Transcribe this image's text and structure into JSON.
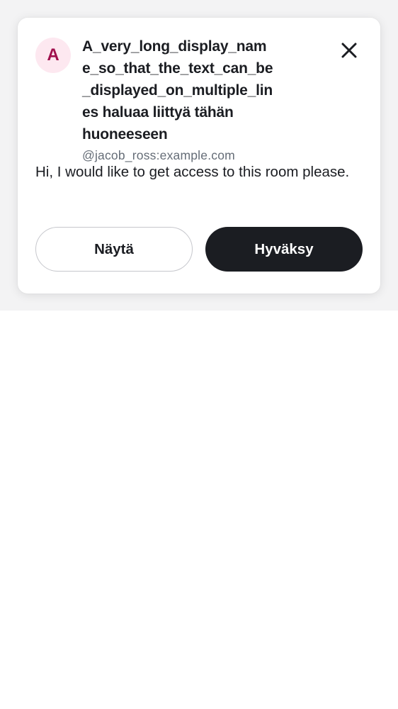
{
  "request": {
    "avatar_initial": "A",
    "display_name": "A_very_long_display_name_so_that_the_text_can_be_displayed_on_multiple_lines",
    "action_text": "haluaa liittyä tähän huoneeseen",
    "user_id": "@jacob_ross:example.com",
    "message": "Hi, I would like to get access to this room please."
  },
  "actions": {
    "view_label": "Näytä",
    "accept_label": "Hyväksy"
  },
  "icons": {
    "close": "close-icon"
  },
  "colors": {
    "avatar_bg": "#fde8f0",
    "avatar_fg": "#a0104d",
    "primary_button": "#1b1d22",
    "text_secondary": "#656d77"
  }
}
